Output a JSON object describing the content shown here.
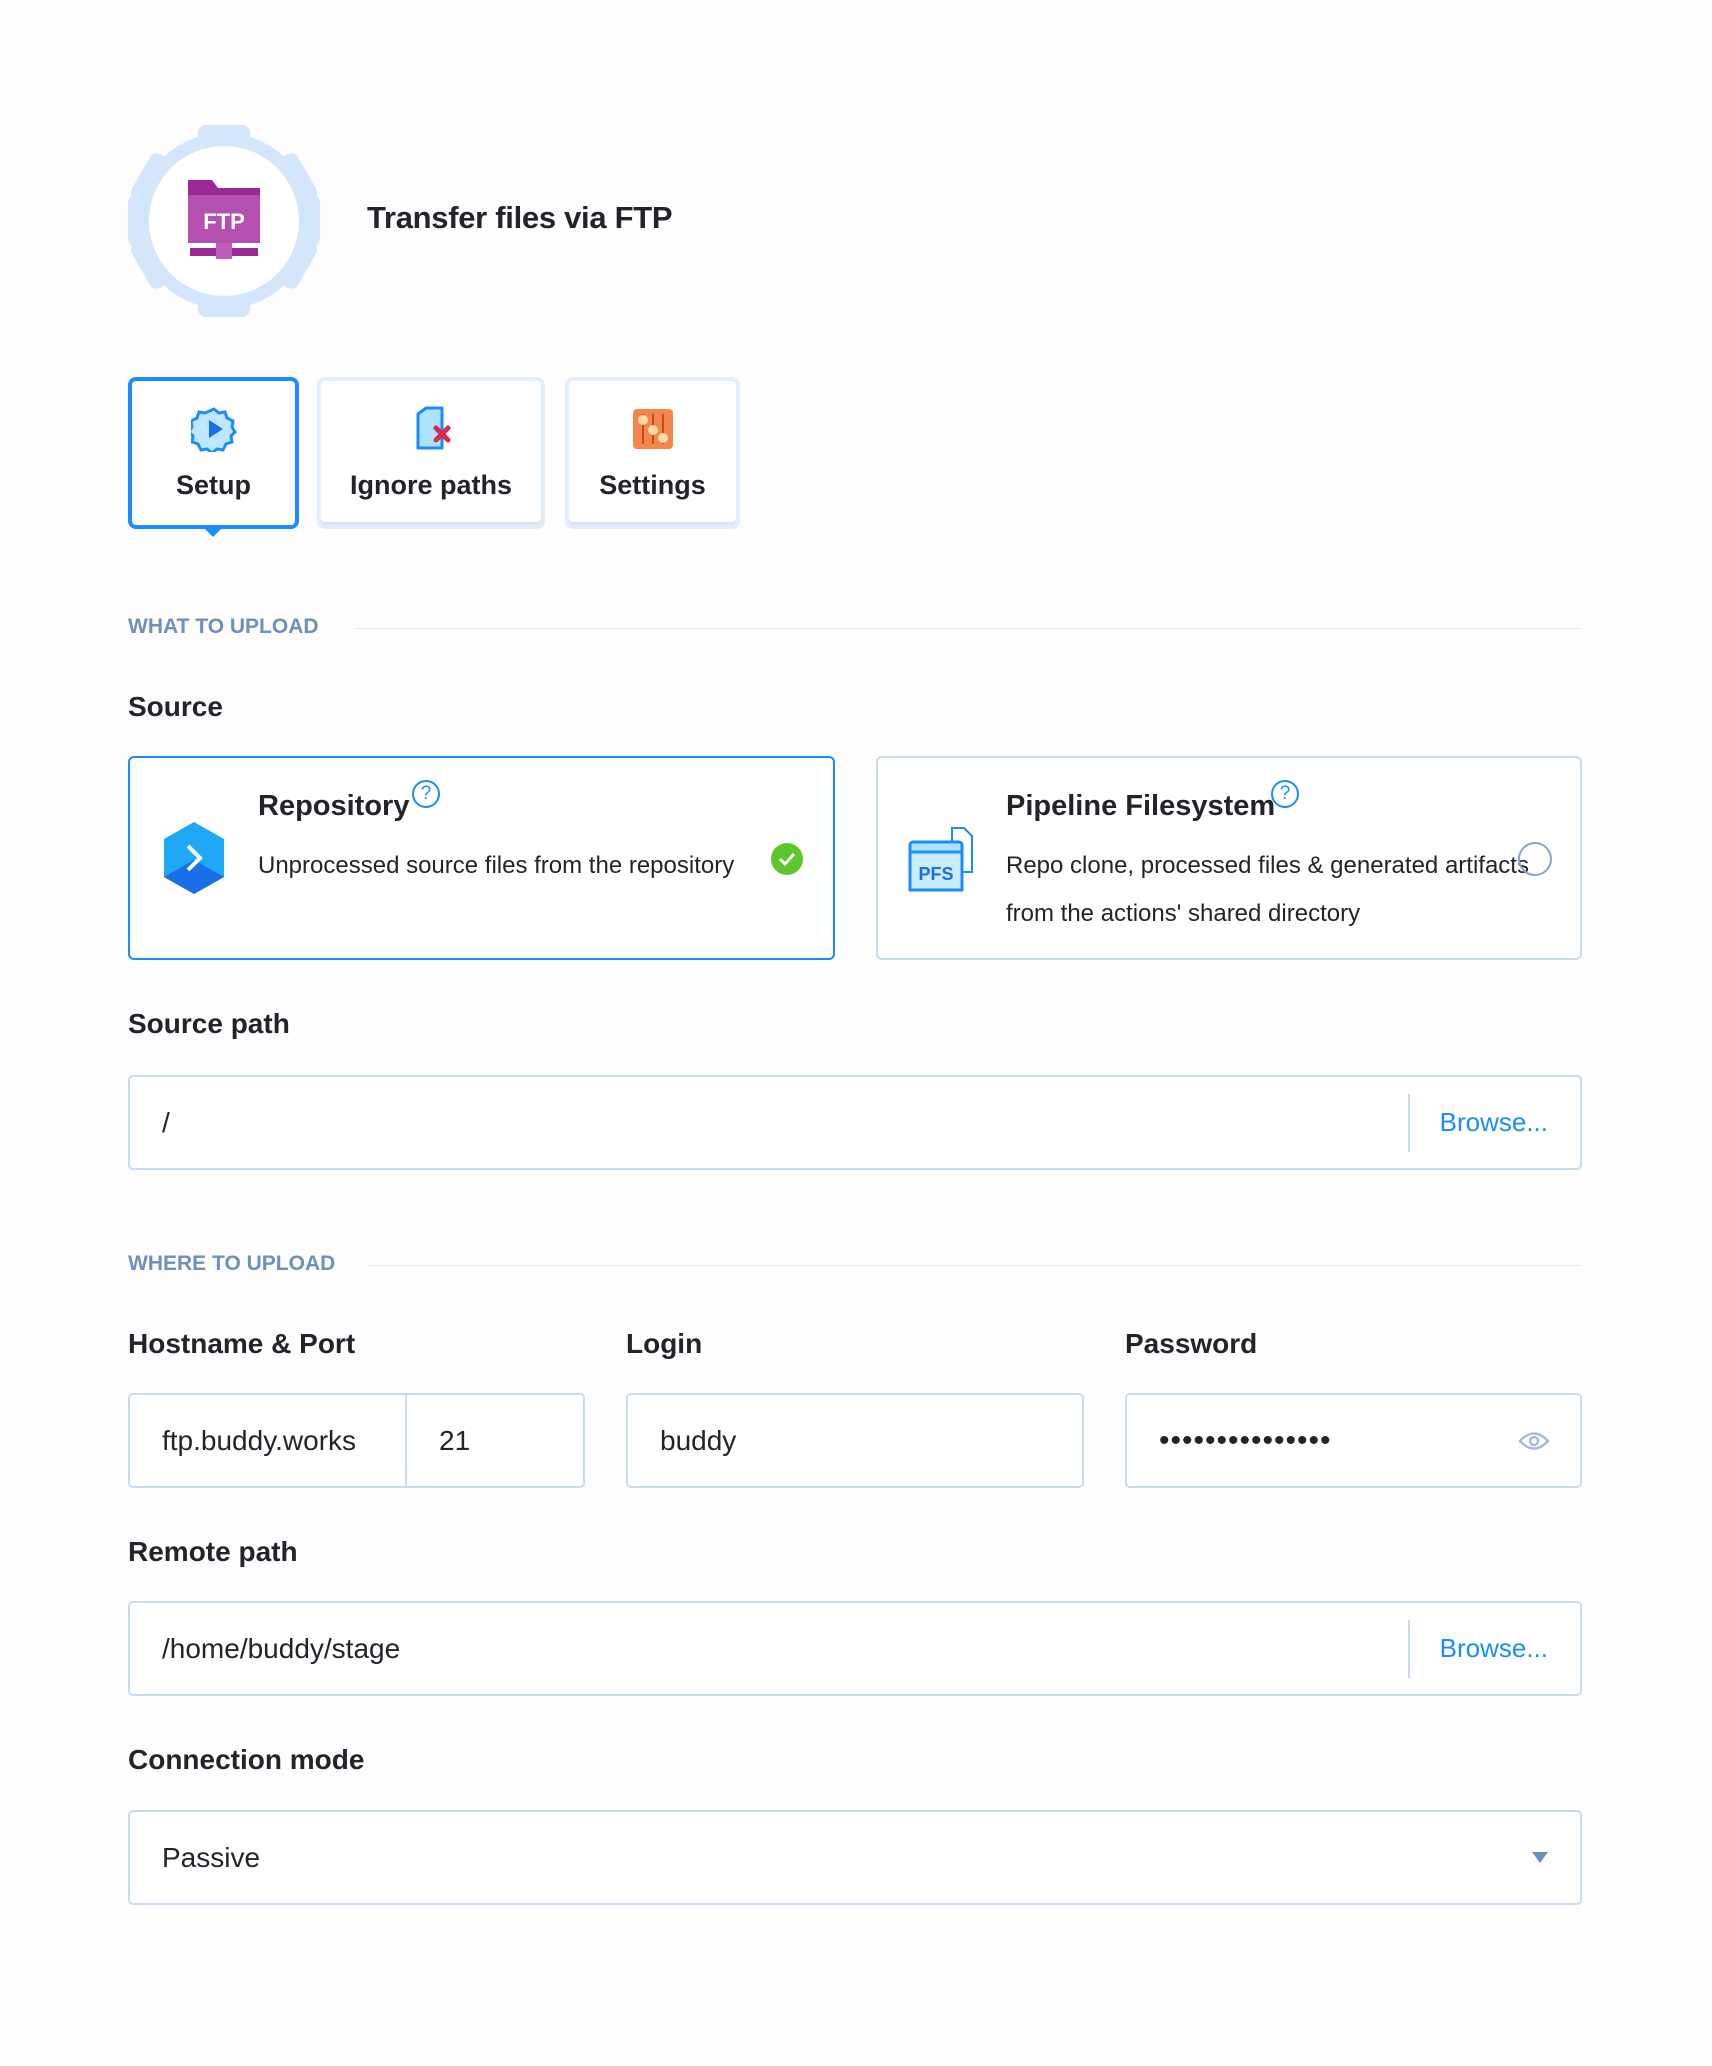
{
  "header": {
    "title": "Transfer files via FTP",
    "logo_text": "FTP",
    "logo_icon": "ftp-folder-icon"
  },
  "tabs": [
    {
      "label": "Setup",
      "icon": "gear-play-icon",
      "active": true
    },
    {
      "label": "Ignore paths",
      "icon": "file-x-icon",
      "active": false
    },
    {
      "label": "Settings",
      "icon": "sliders-icon",
      "active": false
    }
  ],
  "what_section": "WHAT TO UPLOAD",
  "source": {
    "label": "Source",
    "options": [
      {
        "title": "Repository",
        "description": "Unprocessed source files from the repository",
        "selected": true,
        "icon": "repository-icon"
      },
      {
        "title": "Pipeline Filesystem",
        "description": "Repo clone, processed files & generated artifacts from the actions' shared directory",
        "selected": false,
        "icon": "pfs-icon",
        "icon_text": "PFS"
      }
    ]
  },
  "source_path": {
    "label": "Source path",
    "value": "/",
    "browse": "Browse..."
  },
  "where_section": "WHERE TO UPLOAD",
  "hostname": {
    "label": "Hostname & Port",
    "host": "ftp.buddy.works",
    "port": "21"
  },
  "login": {
    "label": "Login",
    "value": "buddy"
  },
  "password": {
    "label": "Password",
    "value": "•••••••••••••••"
  },
  "remote_path": {
    "label": "Remote path",
    "value": "/home/buddy/stage",
    "browse": "Browse..."
  },
  "connection_mode": {
    "label": "Connection mode",
    "value": "Passive"
  },
  "colors": {
    "accent": "#1a8cff",
    "success": "#5cc72c",
    "ftp": "#9c2a96",
    "border": "#c9daf2",
    "section": "#6f8fbd"
  }
}
